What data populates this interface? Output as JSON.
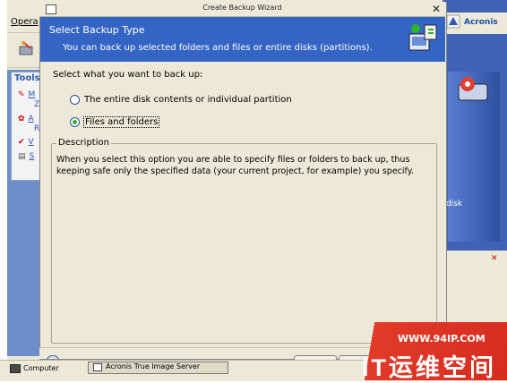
{
  "background_app": {
    "menu_label": "Opera",
    "tools_title": "Tools",
    "tool_letters": [
      "M",
      "Z",
      "A",
      "R",
      "V",
      "S"
    ],
    "brand_logo_text": "Acronis",
    "panel_label": "disk"
  },
  "dialog": {
    "window_title": "Create Backup Wizard",
    "header_title": "Select Backup Type",
    "header_subtitle": "You can back up selected folders and files or entire disks (partitions).",
    "prompt": "Select what you want to back up:",
    "options": [
      {
        "label": "The entire disk contents or individual partition",
        "selected": false
      },
      {
        "label": "Files and folders",
        "selected": true
      }
    ],
    "description_legend": "Description",
    "description_text": "When you select this option you are able to specify files or folders to back up, thus keeping safe only the specified data (your current project, for example) you specify."
  },
  "taskbar": {
    "computer_label": "Computer",
    "task_label": "Acronis True Image Server"
  },
  "watermark": {
    "url": "WWW.94IP.COM",
    "brand": "IT运维空间"
  },
  "colors": {
    "header_blue": "#3565c4",
    "dialog_bg": "#ece9d8",
    "watermark_red": "#d62c1f"
  }
}
